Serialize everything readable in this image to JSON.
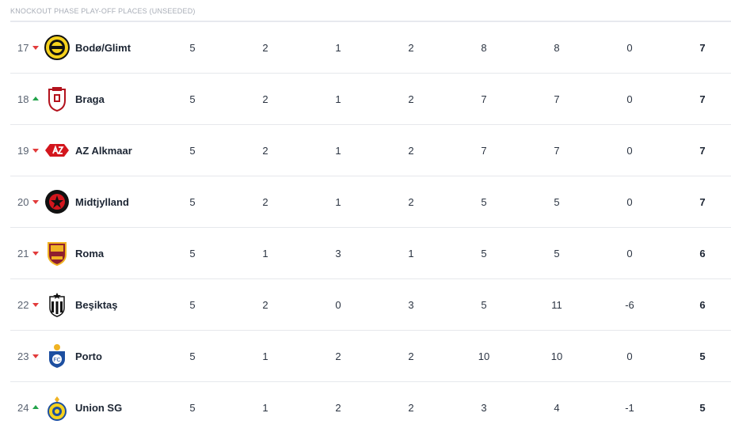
{
  "section": {
    "title": "KNOCKOUT PHASE PLAY-OFF PLACES (UNSEEDED)"
  },
  "rows": [
    {
      "pos": "17",
      "trend": "down",
      "team": "Bodø/Glimt",
      "crest": "bodo-glimt-crest",
      "p": "5",
      "w": "2",
      "d": "1",
      "l": "2",
      "gf": "8",
      "ga": "8",
      "gd": "0",
      "pts": "7"
    },
    {
      "pos": "18",
      "trend": "up",
      "team": "Braga",
      "crest": "braga-crest",
      "p": "5",
      "w": "2",
      "d": "1",
      "l": "2",
      "gf": "7",
      "ga": "7",
      "gd": "0",
      "pts": "7"
    },
    {
      "pos": "19",
      "trend": "down",
      "team": "AZ Alkmaar",
      "crest": "az-alkmaar-crest",
      "p": "5",
      "w": "2",
      "d": "1",
      "l": "2",
      "gf": "7",
      "ga": "7",
      "gd": "0",
      "pts": "7"
    },
    {
      "pos": "20",
      "trend": "down",
      "team": "Midtjylland",
      "crest": "midtjylland-crest",
      "p": "5",
      "w": "2",
      "d": "1",
      "l": "2",
      "gf": "5",
      "ga": "5",
      "gd": "0",
      "pts": "7"
    },
    {
      "pos": "21",
      "trend": "down",
      "team": "Roma",
      "crest": "roma-crest",
      "p": "5",
      "w": "1",
      "d": "3",
      "l": "1",
      "gf": "5",
      "ga": "5",
      "gd": "0",
      "pts": "6"
    },
    {
      "pos": "22",
      "trend": "down",
      "team": "Beşiktaş",
      "crest": "besiktas-crest",
      "p": "5",
      "w": "2",
      "d": "0",
      "l": "3",
      "gf": "5",
      "ga": "11",
      "gd": "-6",
      "pts": "6"
    },
    {
      "pos": "23",
      "trend": "down",
      "team": "Porto",
      "crest": "porto-crest",
      "p": "5",
      "w": "1",
      "d": "2",
      "l": "2",
      "gf": "10",
      "ga": "10",
      "gd": "0",
      "pts": "5"
    },
    {
      "pos": "24",
      "trend": "up",
      "team": "Union SG",
      "crest": "union-sg-crest",
      "p": "5",
      "w": "1",
      "d": "2",
      "l": "2",
      "gf": "3",
      "ga": "4",
      "gd": "-1",
      "pts": "5"
    }
  ]
}
